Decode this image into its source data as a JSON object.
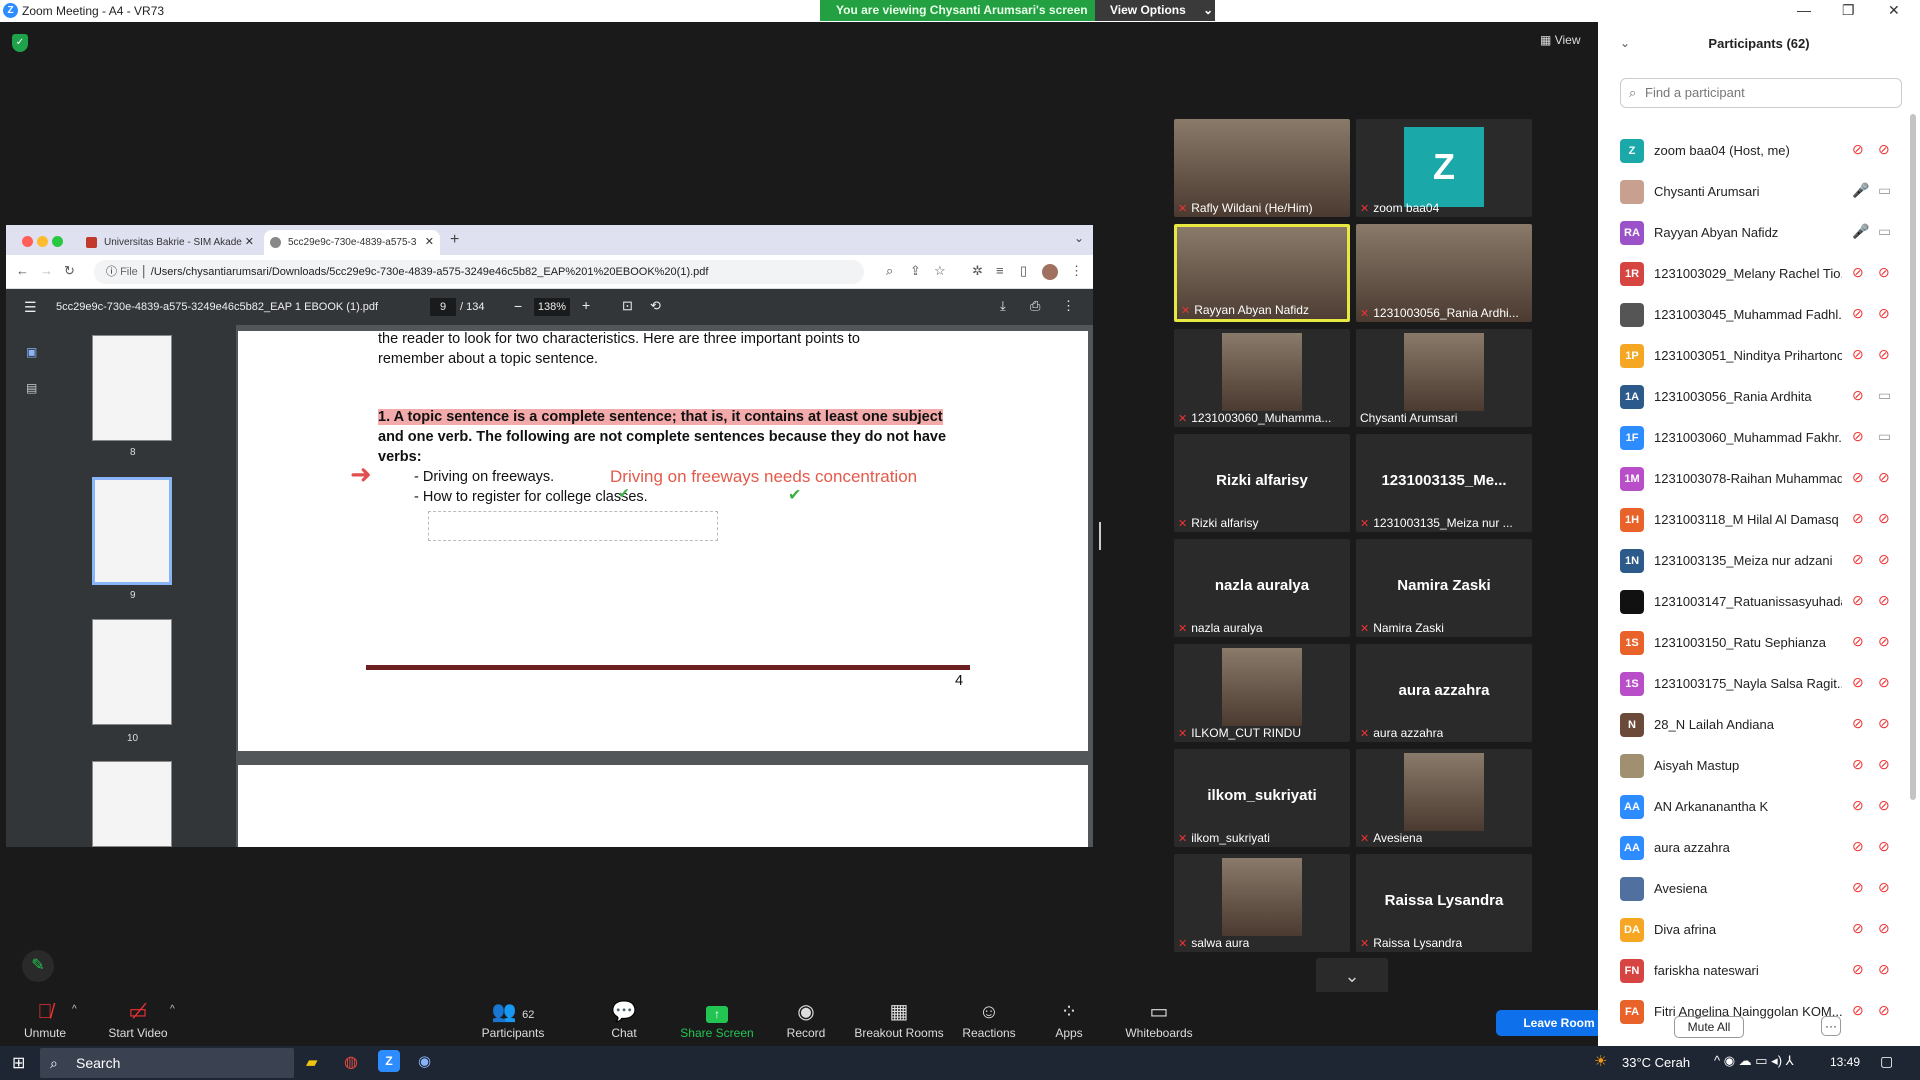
{
  "window": {
    "title": "Zoom Meeting - A4 - VR73",
    "banner": "You are viewing Chysanti Arumsari's screen",
    "view_options": "View Options"
  },
  "view_label": "View",
  "browser": {
    "tabs": [
      "Universitas Bakrie - SIM Akade",
      "5cc29e9c-730e-4839-a575-3"
    ],
    "url_prefix": "File",
    "url": "/Users/chysantiarumsari/Downloads/5cc29e9c-730e-4839-a575-3249e46c5b82_EAP%201%20EBOOK%20(1).pdf",
    "pdf_title": "5cc29e9c-730e-4839-a575-3249e46c5b82_EAP 1 EBOOK (1).pdf",
    "page_current": "9",
    "page_total": "/ 134",
    "zoom": "138%",
    "thumb_labels": [
      "8",
      "9",
      "10"
    ]
  },
  "document": {
    "line1": "the reader to look for two characteristics. Here are three important points to",
    "line2": "remember about a topic sentence.",
    "p1a": "1. A topic sentence is a complete sentence; that is, it contains at least one subject",
    "p1b": "and one verb. The following are not complete sentences because they do not have",
    "p1c": "verbs:",
    "b1": "- Driving on freeways.",
    "b2": "- How to register for college classes.",
    "annotation": "Driving on freeways needs concentration",
    "page_number": "4"
  },
  "videos": [
    {
      "name": "Rafly Wildani (He/Him)",
      "big": "",
      "kind": "photo"
    },
    {
      "name": "zoom baa04",
      "big": "Z",
      "kind": "avatar"
    },
    {
      "name": "Rayyan Abyan Nafidz",
      "big": "",
      "kind": "photo"
    },
    {
      "name": "1231003056_Rania Ardhi...",
      "big": "",
      "kind": "photo"
    },
    {
      "name": "1231003060_Muhamma...",
      "big": "",
      "kind": "photo"
    },
    {
      "name": "Chysanti Arumsari",
      "big": "",
      "kind": "photo"
    },
    {
      "name": "Rizki alfarisy",
      "big": "Rizki alfarisy",
      "kind": "text"
    },
    {
      "name": "1231003135_Meiza nur ...",
      "big": "1231003135_Me...",
      "kind": "text"
    },
    {
      "name": "nazla auralya",
      "big": "nazla auralya",
      "kind": "text"
    },
    {
      "name": "Namira Zaski",
      "big": "Namira Zaski",
      "kind": "text"
    },
    {
      "name": "ILKOM_CUT RINDU",
      "big": "",
      "kind": "photo"
    },
    {
      "name": "aura azzahra",
      "big": "aura azzahra",
      "kind": "text"
    },
    {
      "name": "ilkom_sukriyati",
      "big": "ilkom_sukriyati",
      "kind": "text"
    },
    {
      "name": "Avesiena",
      "big": "",
      "kind": "photo"
    },
    {
      "name": "salwa aura",
      "big": "",
      "kind": "photo"
    },
    {
      "name": "Raissa Lysandra",
      "big": "Raissa Lysandra",
      "kind": "text"
    }
  ],
  "toolbar": {
    "unmute": "Unmute",
    "start_video": "Start Video",
    "participants": "Participants",
    "participants_count": "62",
    "chat": "Chat",
    "share": "Share Screen",
    "record": "Record",
    "breakout": "Breakout Rooms",
    "reactions": "Reactions",
    "apps": "Apps",
    "whiteboards": "Whiteboards",
    "leave": "Leave Room"
  },
  "panel": {
    "title": "Participants (62)",
    "search_placeholder": "Find a participant",
    "mute_all": "Mute All",
    "participants": [
      {
        "initials": "Z",
        "name": "zoom baa04 (Host, me)",
        "color": "#1aa8a8"
      },
      {
        "initials": "",
        "name": "Chysanti Arumsari",
        "color": "#c8a090"
      },
      {
        "initials": "RA",
        "name": "Rayyan Abyan Nafidz",
        "color": "#9b51c8"
      },
      {
        "initials": "1R",
        "name": "1231003029_Melany Rachel Tio...",
        "color": "#d64541"
      },
      {
        "initials": "",
        "name": "1231003045_Muhammad Fadhl...",
        "color": "#555555"
      },
      {
        "initials": "1P",
        "name": "1231003051_Ninditya Prihartono",
        "color": "#f5a623"
      },
      {
        "initials": "1A",
        "name": "1231003056_Rania Ardhita",
        "color": "#2c5a8a"
      },
      {
        "initials": "1F",
        "name": "1231003060_Muhammad Fakhr...",
        "color": "#2d8cff"
      },
      {
        "initials": "1M",
        "name": "1231003078-Raihan Muhammad",
        "color": "#b84fc8"
      },
      {
        "initials": "1H",
        "name": "1231003118_M Hilal Al Damasq",
        "color": "#e8622a"
      },
      {
        "initials": "1N",
        "name": "1231003135_Meiza nur adzani",
        "color": "#2c5a8a"
      },
      {
        "initials": "",
        "name": "1231003147_Ratuanissasyuhada",
        "color": "#111111"
      },
      {
        "initials": "1S",
        "name": "1231003150_Ratu Sephianza",
        "color": "#e8622a"
      },
      {
        "initials": "1S",
        "name": "1231003175_Nayla Salsa Ragit...",
        "color": "#b84fc8"
      },
      {
        "initials": "N",
        "name": "28_N Lailah Andiana",
        "color": "#6b4a3a"
      },
      {
        "initials": "",
        "name": "Aisyah Mastup",
        "color": "#a09070"
      },
      {
        "initials": "AA",
        "name": "AN Arkananantha K",
        "color": "#2d8cff"
      },
      {
        "initials": "AA",
        "name": "aura azzahra",
        "color": "#2d8cff"
      },
      {
        "initials": "",
        "name": "Avesiena",
        "color": "#5070a0"
      },
      {
        "initials": "DA",
        "name": "Diva afrina",
        "color": "#f5a623"
      },
      {
        "initials": "FN",
        "name": "fariskha nateswari",
        "color": "#d64541"
      },
      {
        "initials": "FA",
        "name": "Fitri Angelina Nainggolan KOM...",
        "color": "#e8622a"
      }
    ]
  },
  "taskbar": {
    "search": "Search",
    "weather": "33°C  Cerah",
    "time": "13:49"
  }
}
